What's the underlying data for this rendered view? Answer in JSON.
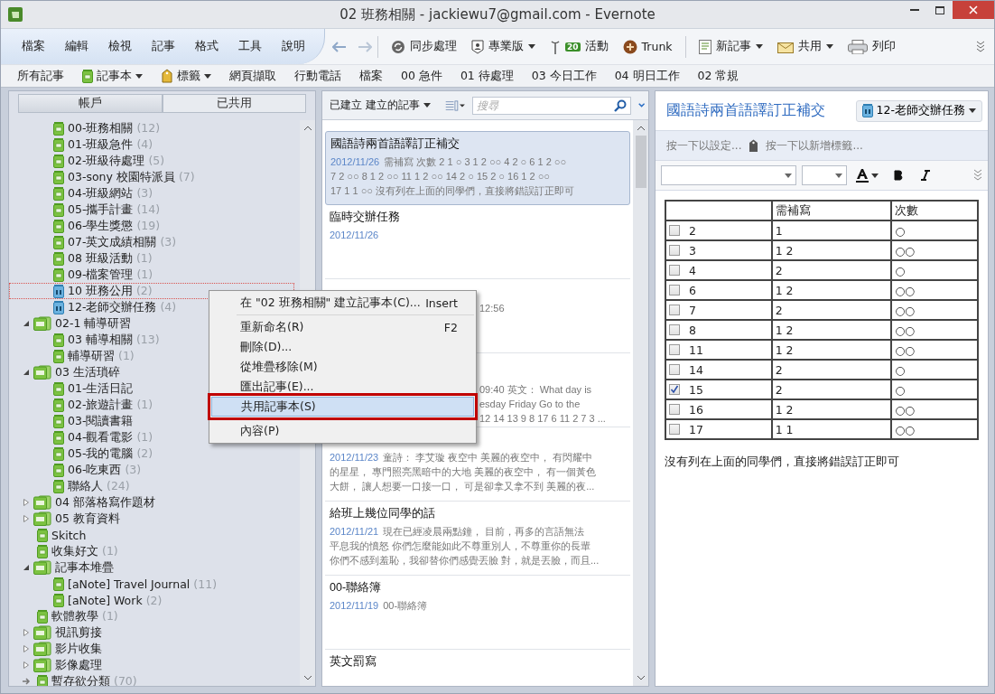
{
  "window": {
    "title": "02 班務相關 - jackiewu7@gmail.com - Evernote"
  },
  "menu": [
    "檔案",
    "編輯",
    "檢視",
    "記事",
    "格式",
    "工具",
    "說明"
  ],
  "toolbar": [
    {
      "kind": "sync",
      "label": "同步處理",
      "dropdown": false
    },
    {
      "kind": "premium",
      "label": "專業版",
      "dropdown": true
    },
    {
      "kind": "activity",
      "label": "活動",
      "badge": "20",
      "dropdown": false
    },
    {
      "kind": "trunk",
      "label": "Trunk",
      "dropdown": false
    },
    {
      "kind": "new_note",
      "label": "新記事",
      "dropdown": true
    },
    {
      "kind": "share",
      "label": "共用",
      "dropdown": true
    },
    {
      "kind": "print",
      "label": "列印",
      "dropdown": false
    }
  ],
  "bookmarks": [
    {
      "kind": "plain",
      "label": "所有記事",
      "dropdown": false
    },
    {
      "kind": "notebook",
      "label": "記事本",
      "dropdown": true
    },
    {
      "kind": "tag",
      "label": "標籤",
      "dropdown": true
    },
    {
      "kind": "plain",
      "label": "網頁擷取",
      "dropdown": false
    },
    {
      "kind": "plain",
      "label": "行動電話",
      "dropdown": false
    },
    {
      "kind": "plain",
      "label": "檔案",
      "dropdown": false
    },
    {
      "kind": "plain",
      "label": "00 急件",
      "dropdown": false
    },
    {
      "kind": "plain",
      "label": "01 待處理",
      "dropdown": false
    },
    {
      "kind": "plain",
      "label": "03 今日工作",
      "dropdown": false
    },
    {
      "kind": "plain",
      "label": "04 明日工作",
      "dropdown": false
    },
    {
      "kind": "plain",
      "label": "02 常規",
      "dropdown": false
    }
  ],
  "sidebar": {
    "tabs": [
      {
        "label": "帳戶",
        "selected": true
      },
      {
        "label": "已共用",
        "selected": false
      }
    ],
    "tree": [
      {
        "kind": "group",
        "children": [
          {
            "kind": "notebook",
            "label": "00-班務相關",
            "count": "(12)",
            "selected": false
          },
          {
            "kind": "notebook",
            "label": "01-班級急件",
            "count": "(4)",
            "selected": false
          },
          {
            "kind": "notebook",
            "label": "02-班級待處理",
            "count": "(5)",
            "selected": false
          },
          {
            "kind": "notebook",
            "label": "03-sony 校園特派員",
            "count": "(7)",
            "selected": false
          },
          {
            "kind": "notebook",
            "label": "04-班級網站",
            "count": "(3)",
            "selected": false
          },
          {
            "kind": "notebook",
            "label": "05-攜手計畫",
            "count": "(14)",
            "selected": false
          },
          {
            "kind": "notebook",
            "label": "06-學生獎懲",
            "count": "(19)",
            "selected": false
          },
          {
            "kind": "notebook",
            "label": "07-英文成績相關",
            "count": "(3)",
            "selected": false
          },
          {
            "kind": "notebook",
            "label": "08 班級活動",
            "count": "(1)",
            "selected": false
          },
          {
            "kind": "notebook",
            "label": "09-檔案管理",
            "count": "(1)",
            "selected": false
          },
          {
            "kind": "shared",
            "label": "10 班務公用",
            "count": "(2)",
            "selected": true
          },
          {
            "kind": "shared",
            "label": "12-老師交辦任務",
            "count": "(4)",
            "selected": false
          }
        ]
      },
      {
        "kind": "stack",
        "label": "02-1 輔導研習",
        "expanded": true,
        "children": [
          {
            "kind": "notebook",
            "label": "03 輔導相關",
            "count": "(13)",
            "selected": false
          },
          {
            "kind": "notebook",
            "label": "輔導研習",
            "count": "(1)",
            "selected": false
          }
        ]
      },
      {
        "kind": "stack",
        "label": "03 生活瑣碎",
        "expanded": true,
        "children": [
          {
            "kind": "notebook",
            "label": "01-生活日記",
            "selected": false
          },
          {
            "kind": "notebook",
            "label": "02-旅遊計畫",
            "count": "(1)",
            "selected": false
          },
          {
            "kind": "notebook",
            "label": "03-閱讀書籍",
            "selected": false
          },
          {
            "kind": "notebook",
            "label": "04-觀看電影",
            "count": "(1)",
            "selected": false
          },
          {
            "kind": "notebook",
            "label": "05-我的電腦",
            "count": "(2)",
            "selected": false
          },
          {
            "kind": "notebook",
            "label": "06-吃東西",
            "count": "(3)",
            "selected": false
          },
          {
            "kind": "notebook",
            "label": "聯絡人",
            "count": "(24)",
            "selected": false
          }
        ]
      },
      {
        "kind": "stack",
        "label": "04 部落格寫作題材",
        "expanded": false
      },
      {
        "kind": "stack",
        "label": "05 教育資料",
        "expanded": false
      },
      {
        "kind": "notebook",
        "label": "Skitch",
        "selected": false
      },
      {
        "kind": "notebook",
        "label": "收集好文",
        "count": "(1)",
        "selected": false
      },
      {
        "kind": "stack",
        "label": "記事本堆疊",
        "expanded": true,
        "children": [
          {
            "kind": "notebook",
            "label": "[aNote] Travel Journal",
            "count": "(11)",
            "selected": false
          },
          {
            "kind": "notebook",
            "label": "[aNote] Work",
            "count": "(2)",
            "selected": false
          }
        ]
      },
      {
        "kind": "notebook",
        "label": "軟體教學",
        "count": "(1)",
        "selected": false
      },
      {
        "kind": "stack",
        "label": "視訊剪接",
        "expanded": false
      },
      {
        "kind": "stack",
        "label": "影片收集",
        "expanded": false
      },
      {
        "kind": "stack",
        "label": "影像處理",
        "expanded": false
      },
      {
        "kind": "default",
        "label": "暫存欲分類",
        "count": "(70)",
        "selected": false
      }
    ]
  },
  "notes": {
    "sort_label": "已建立 建立的記事",
    "search": {
      "placeholder": "搜尋"
    },
    "items": [
      {
        "kind": "note",
        "title": "國語詩兩首語譯訂正補交",
        "date": "2012/11/26",
        "lines": [
          "需補寫 次數 2 1 ○ 3 1 2 ○○ 4 2 ○ 6 1 2 ○○",
          "7 2 ○○ 8 1 2 ○○ 11 1 2 ○○ 14 2 ○ 15 2 ○ 16 1 2 ○○",
          "17 1 1 ○○ 沒有列在上面的同學們，直接將錯誤訂正即可"
        ],
        "selected": true
      },
      {
        "kind": "note",
        "title": "臨時交辦任務",
        "date": "2012/11/26",
        "selected": false
      },
      {
        "kind": "covered",
        "lines": [
          "12:56"
        ],
        "selected": false
      },
      {
        "kind": "covered",
        "lines": [
          "09:40 英文： What day is",
          "esday Friday Go to the",
          "12 14 13 9 8 17 6 11 2 7 3 ..."
        ],
        "selected": false
      },
      {
        "kind": "note",
        "date": "2012/11/23",
        "lines": [
          "童詩： 李艾璇 夜空中 美麗的夜空中， 有閃耀中",
          "的星星， 專門照亮黑暗中的大地 美麗的夜空中， 有一個黃色",
          "大餅， 讓人想要一口接一口， 可是卻拿又拿不到 美麗的夜..."
        ],
        "selected": false
      },
      {
        "kind": "note",
        "title": "給班上幾位同學的話",
        "date": "2012/11/21",
        "lines": [
          "現在已經凌晨兩點鐘， 目前，再多的言語無法",
          "平息我的憤怒 你們怎麼能如此不尊重別人，不尊重你的長輩",
          "你們不感到羞恥，我卻替你們感覺丟臉 對，就是丟臉，而且..."
        ],
        "selected": false
      },
      {
        "kind": "note",
        "title": "00-聯絡簿",
        "date": "2012/11/19",
        "lines": [
          "00-聯絡簿"
        ],
        "selected": false
      },
      {
        "kind": "note",
        "title": "英文罰寫",
        "selected": false
      }
    ]
  },
  "editor": {
    "title": "國語詩兩首語譯訂正補交",
    "notebook": "12-老師交辦任務",
    "source_hint": "按一下以設定...",
    "tag_hint": "按一下以新增標籤...",
    "table": {
      "columns": [
        "需補寫",
        "次數"
      ],
      "rows": [
        {
          "number": "2",
          "checked": false,
          "cells": [
            "1",
            "○"
          ]
        },
        {
          "number": "3",
          "checked": false,
          "cells": [
            "1 2",
            "○○"
          ]
        },
        {
          "number": "4",
          "checked": false,
          "cells": [
            "2",
            "○"
          ]
        },
        {
          "number": "6",
          "checked": false,
          "cells": [
            "1 2",
            "○○"
          ]
        },
        {
          "number": "7",
          "checked": false,
          "cells": [
            "2",
            "○○"
          ]
        },
        {
          "number": "8",
          "checked": false,
          "cells": [
            "1 2",
            "○○"
          ]
        },
        {
          "number": "11",
          "checked": false,
          "cells": [
            "1 2",
            "○○"
          ]
        },
        {
          "number": "14",
          "checked": false,
          "cells": [
            "2",
            "○"
          ]
        },
        {
          "number": "15",
          "checked": true,
          "cells": [
            "2",
            "○"
          ]
        },
        {
          "number": "16",
          "checked": false,
          "cells": [
            "1 2",
            "○○"
          ]
        },
        {
          "number": "17",
          "checked": false,
          "cells": [
            "1 1",
            "○○"
          ]
        }
      ]
    },
    "paragraph": "沒有列在上面的同學們，直接將錯誤訂正即可"
  },
  "context_menu": {
    "items": [
      {
        "label": "在 \"02 班務相關\" 建立記事本(C)...",
        "shortcut": "Insert",
        "selected": false,
        "separator_after": true
      },
      {
        "label": "重新命名(R)",
        "shortcut": "F2",
        "selected": false,
        "separator_after": false
      },
      {
        "label": "刪除(D)...",
        "selected": false,
        "separator_after": false
      },
      {
        "label": "從堆疊移除(M)",
        "selected": false,
        "separator_after": false
      },
      {
        "label": "匯出記事(E)...",
        "selected": false,
        "separator_after": false
      },
      {
        "label": "共用記事本(S)",
        "selected": true,
        "separator_after": true
      },
      {
        "label": "內容(P)",
        "selected": false,
        "separator_after": false
      }
    ]
  }
}
